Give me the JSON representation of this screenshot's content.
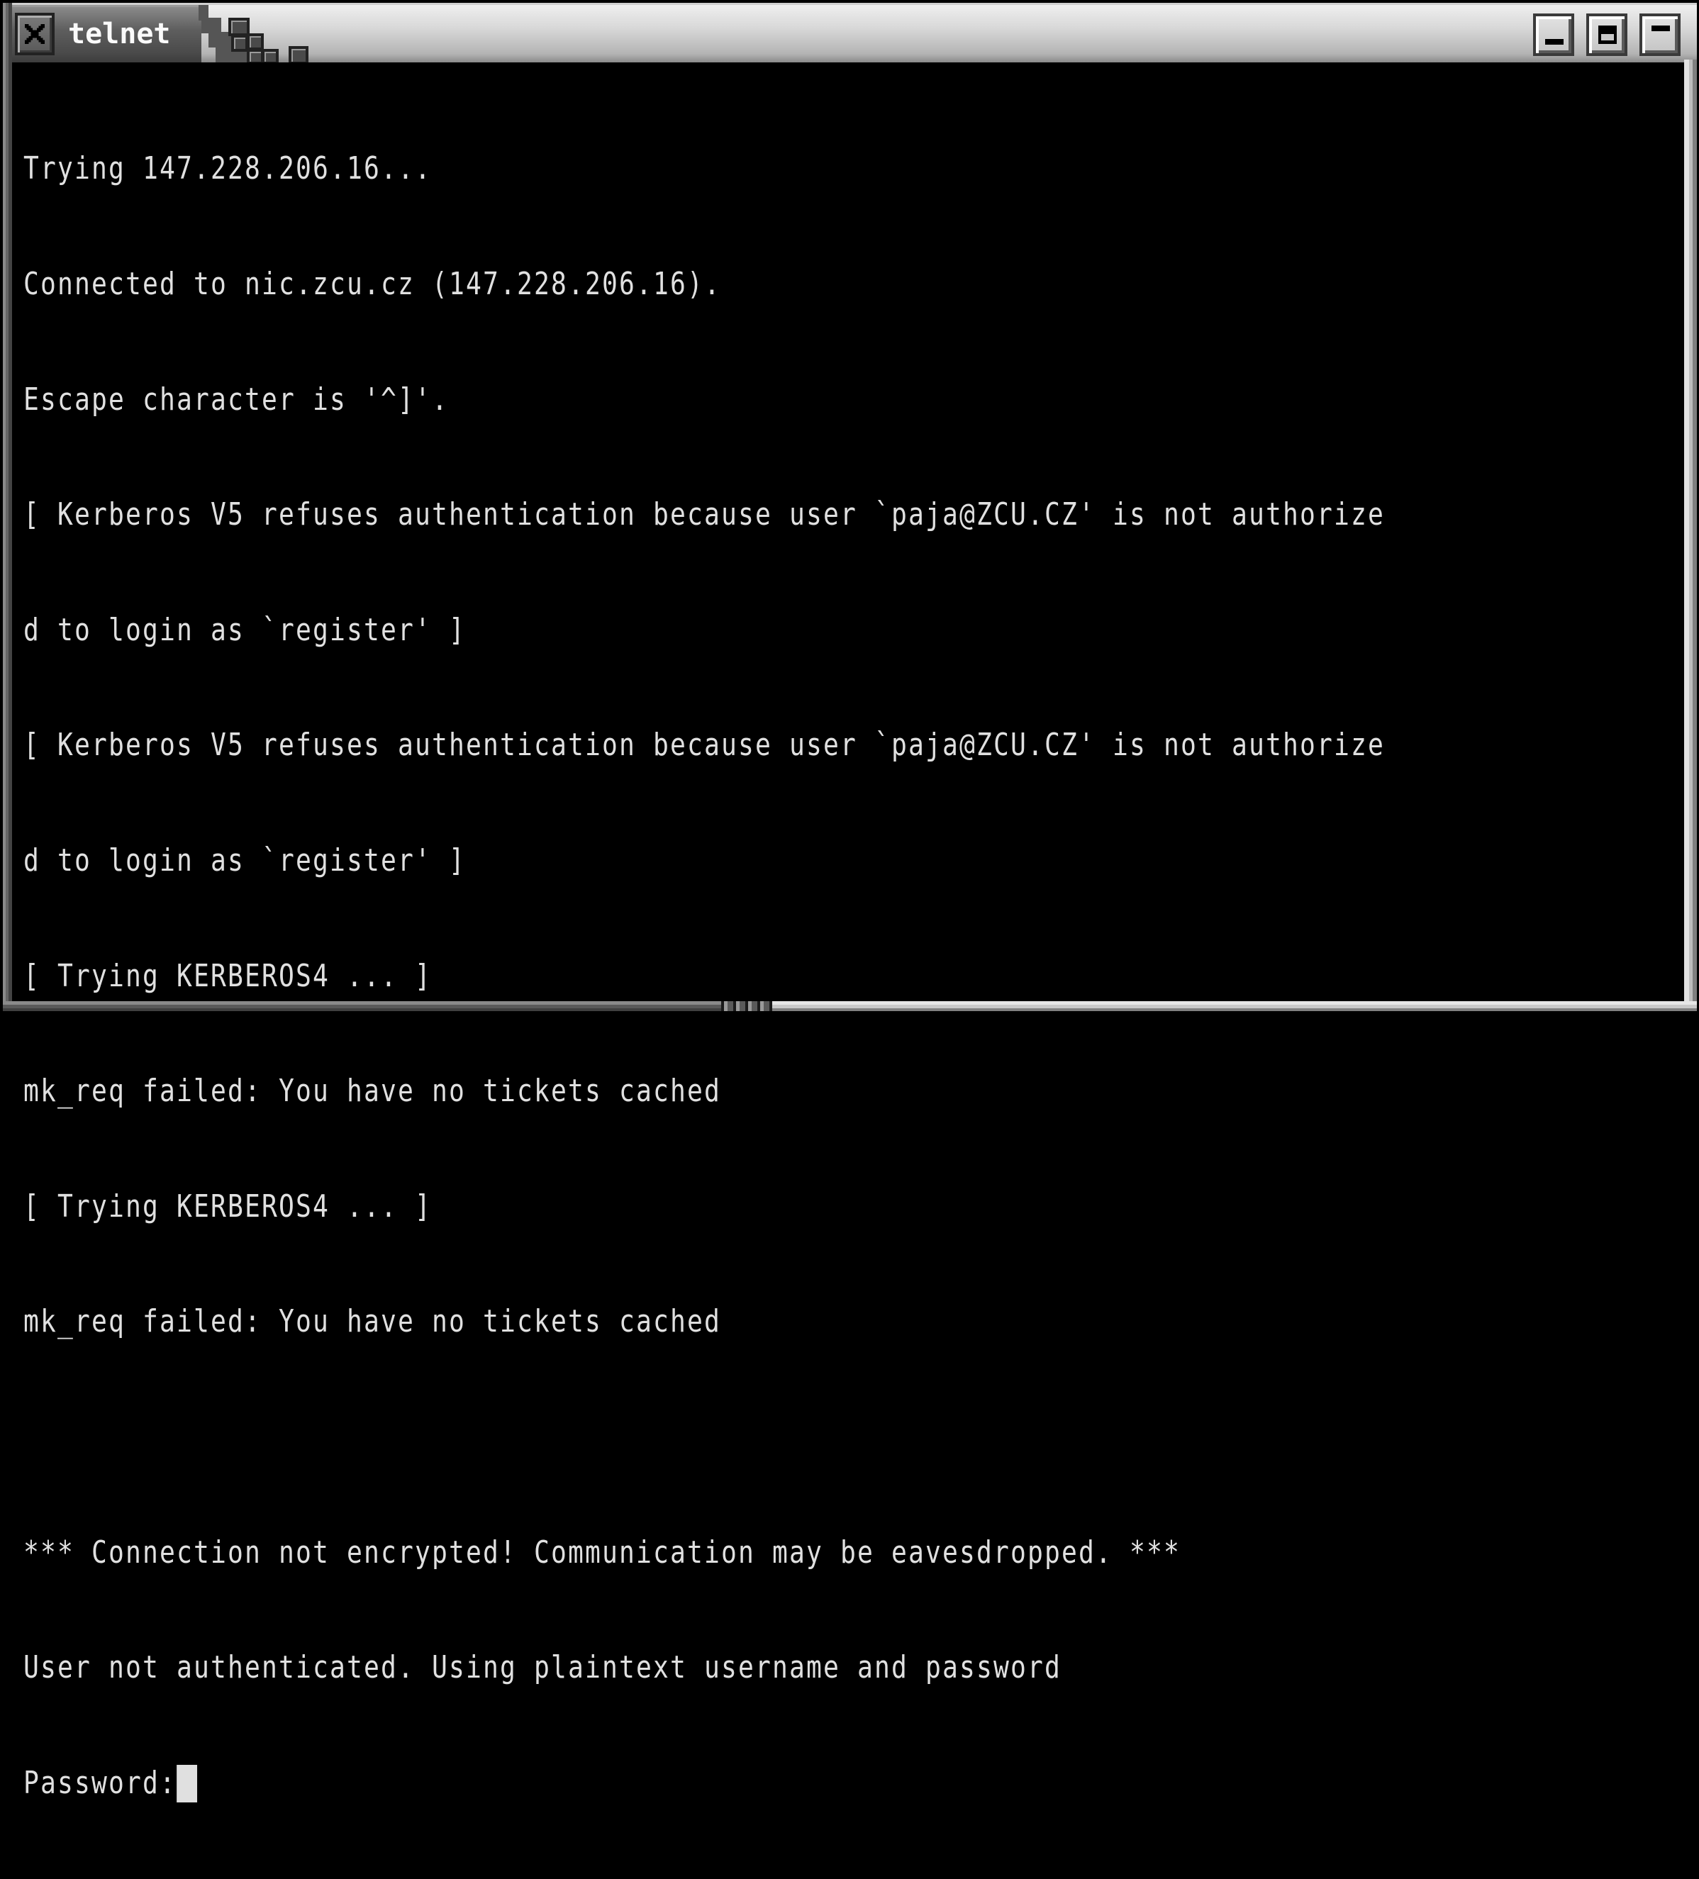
{
  "window": {
    "title": "telnet",
    "icons": {
      "close": "close-x-icon",
      "minimize": "minimize-icon",
      "maximize": "maximize-icon",
      "shade": "shade-icon"
    }
  },
  "terminal": {
    "columns": 80,
    "colors": {
      "background": "#000000",
      "foreground": "#e0e0e0"
    },
    "lines": [
      "Trying 147.228.206.16...",
      "Connected to nic.zcu.cz (147.228.206.16).",
      "Escape character is '^]'.",
      "[ Kerberos V5 refuses authentication because user `paja@ZCU.CZ' is not authorize",
      "d to login as `register' ]",
      "[ Kerberos V5 refuses authentication because user `paja@ZCU.CZ' is not authorize",
      "d to login as `register' ]",
      "[ Trying KERBEROS4 ... ]",
      "mk_req failed: You have no tickets cached",
      "[ Trying KERBEROS4 ... ]",
      "mk_req failed: You have no tickets cached",
      "",
      "*** Connection not encrypted! Communication may be eavesdropped. ***",
      "User not authenticated. Using plaintext username and password"
    ],
    "prompt": "Password:",
    "input_value": ""
  }
}
